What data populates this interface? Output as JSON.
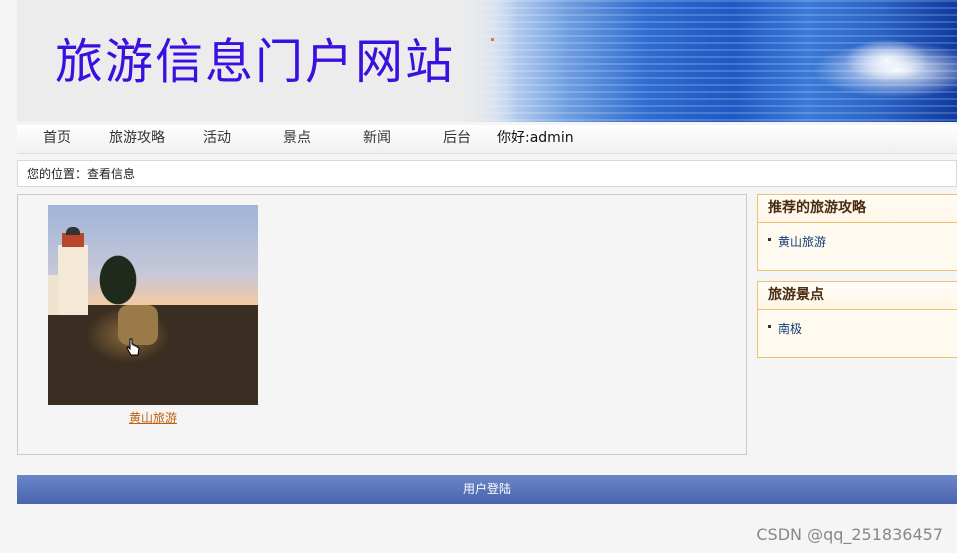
{
  "header": {
    "site_title": "旅游信息门户网站"
  },
  "nav": {
    "items": [
      "首页",
      "旅游攻略",
      "活动",
      "景点",
      "新闻",
      "后台"
    ],
    "greeting": "你好:admin"
  },
  "breadcrumb": {
    "text": "您的位置：查看信息"
  },
  "main": {
    "photo_caption": "黄山旅游"
  },
  "sidebar": {
    "recommended": {
      "title": "推荐的旅游攻略",
      "items": [
        "黄山旅游"
      ]
    },
    "attractions": {
      "title": "旅游景点",
      "items": [
        "南极"
      ]
    }
  },
  "footer": {
    "login_text": "用户登陆"
  },
  "watermark": {
    "text": "CSDN @qq_251836457"
  },
  "colors": {
    "title": "#3a10e0",
    "footer_bar": "#5a74bb",
    "sidebar_border": "#f0c070",
    "caption_link": "#c06010"
  }
}
